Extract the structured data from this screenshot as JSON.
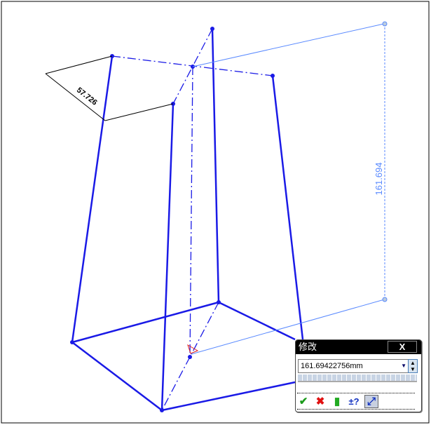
{
  "dimensions": {
    "vertical": "161.694",
    "angled": "57.726"
  },
  "modify_dialog": {
    "title": "修改",
    "close_label": "X",
    "value": "161.69422756mm",
    "buttons": [
      {
        "icon": "check-icon",
        "glyph": "✔"
      },
      {
        "icon": "cross-icon",
        "glyph": "✖"
      },
      {
        "icon": "rebuild-traffic-light-icon",
        "glyph": "▮"
      },
      {
        "icon": "reverse-sense-icon",
        "glyph": "±?"
      },
      {
        "icon": "mark-dimension-icon",
        "glyph": "⤢"
      }
    ]
  },
  "colors": {
    "sketch": "#1010e0",
    "dimension": "#5080ff",
    "construction": "#1010e0"
  }
}
